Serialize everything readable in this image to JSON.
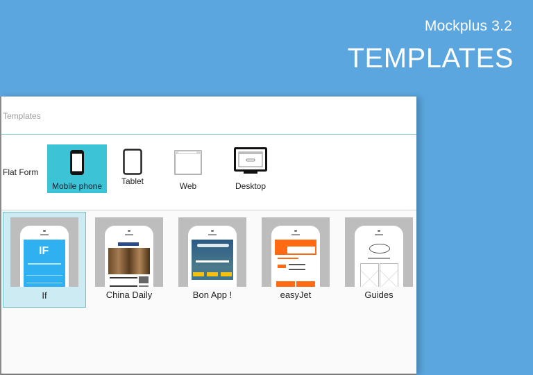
{
  "brand": {
    "subtitle": "Mockplus 3.2",
    "title": "TEMPLATES"
  },
  "window": {
    "title": "Templates",
    "platform_label": "Flat Form",
    "platforms": [
      {
        "label": "Mobile phone",
        "icon": "mobile-phone-icon",
        "active": true
      },
      {
        "label": "Tablet",
        "icon": "tablet-icon",
        "active": false
      },
      {
        "label": "Web",
        "icon": "web-browser-icon",
        "active": false
      },
      {
        "label": "Desktop",
        "icon": "desktop-monitor-icon",
        "active": false
      }
    ],
    "templates": [
      {
        "label": "If",
        "selected": true,
        "screen_color": "#2fb0f0"
      },
      {
        "label": "China Daily",
        "selected": false,
        "screen_color": "#ffffff"
      },
      {
        "label": "Bon App !",
        "selected": false,
        "screen_color": "#2c6e8e"
      },
      {
        "label": "easyJet",
        "selected": false,
        "screen_color": "#ff6a13"
      },
      {
        "label": "Guides",
        "selected": false,
        "screen_color": "#ffffff"
      }
    ]
  },
  "colors": {
    "background": "#5ba6df",
    "accent": "#3dc3d6",
    "selection": "#cdebf2"
  }
}
